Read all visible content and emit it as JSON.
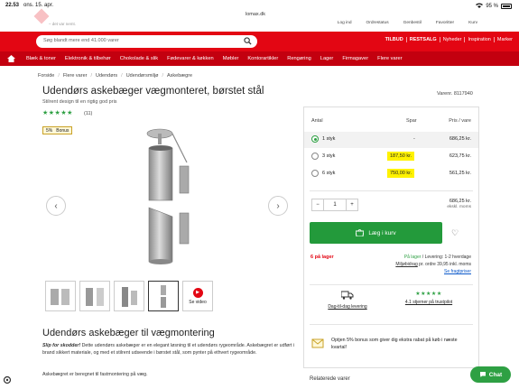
{
  "status": {
    "time": "22.53",
    "date": "ons. 15. apr.",
    "battery": "95 %"
  },
  "browser": {
    "url": "lomax.dk"
  },
  "brand": {
    "tagline": "– det var nemt.",
    "red": "#e30613",
    "green": "#2ea043"
  },
  "utility": [
    "Log ind",
    "Ordrestatus",
    "Genbestil",
    "Favoritter",
    "Kurv"
  ],
  "search": {
    "placeholder": "Søg blandt mere end 41.000 varer"
  },
  "topnav": [
    "TILBUD",
    "RESTSALG",
    "Nyheder",
    "Inspiration",
    "Marker"
  ],
  "categories": [
    "Blæk & toner",
    "Elektronik & tilbehør",
    "Chokolade & slik",
    "Fødevarer & køkken",
    "Møbler",
    "Kontorartikler",
    "Rengøring",
    "Lager",
    "Firmagaver",
    "Flere varer"
  ],
  "breadcrumbs": [
    "Forside",
    "Flere varer",
    "Udendørs",
    "Udendørsmiljø",
    "Askebægre"
  ],
  "product": {
    "title": "Udendørs askebæger vægmonteret, børstet stål",
    "subtitle": "Stilrent design til en rigtig god pris",
    "stars": "★★★★★",
    "reviews": "(11)",
    "bonus_pct": "5%",
    "bonus_label": "Bonus",
    "varenr": "Varenr. 8117940",
    "video_label": "Se video"
  },
  "pricebox": {
    "headers": {
      "antal": "Antal",
      "spar": "Spar",
      "pris": "Pris / vare"
    },
    "tiers": [
      {
        "qty": "1 styk",
        "save": "-",
        "price": "686,25 kr.",
        "selected": true
      },
      {
        "qty": "3 styk",
        "save": "187,50 kr.",
        "price": "623,75 kr.",
        "selected": false
      },
      {
        "qty": "6 styk",
        "save": "750,00 kr.",
        "price": "561,25 kr.",
        "selected": false
      }
    ],
    "quantity": "1",
    "minus": "−",
    "plus": "+",
    "total": "686,25 kr.",
    "total_note": "ekskl. moms",
    "cart_label": "Læg i kurv",
    "stock": "6 på lager",
    "delivery_green": "På lager",
    "delivery_text": " / Levering: 1-2 hverdage",
    "miljobidrag_link": "Miljøbidrag",
    "miljobidrag_text": " pr. ordre 39,95 inkl. moms",
    "freight_link": "Se fragtpriser",
    "usp1": "Dag-til-dag levering",
    "usp2_stars": "★★★★★",
    "usp2": "4.1 stjerner på trustpilot",
    "bonus_text": "Optjen 5% bonus som giver dig ekstra rabat på køb i næste kvartal!"
  },
  "description": {
    "title": "Udendørs askebæger til vægmontering",
    "lead": "Slip for skodder!",
    "body": " Dette udendørs askebæger er en elegant løsning til et udendørs rygeområde. Askebægret er udført i brand sikkert materiale, og med et stilrent udseende i børstet stål, som pynter på ethvert rygeområde.",
    "body2": "Askebægret er beregnet til fastmontering på væg."
  },
  "related": "Relaterede varer",
  "chat": "Chat"
}
